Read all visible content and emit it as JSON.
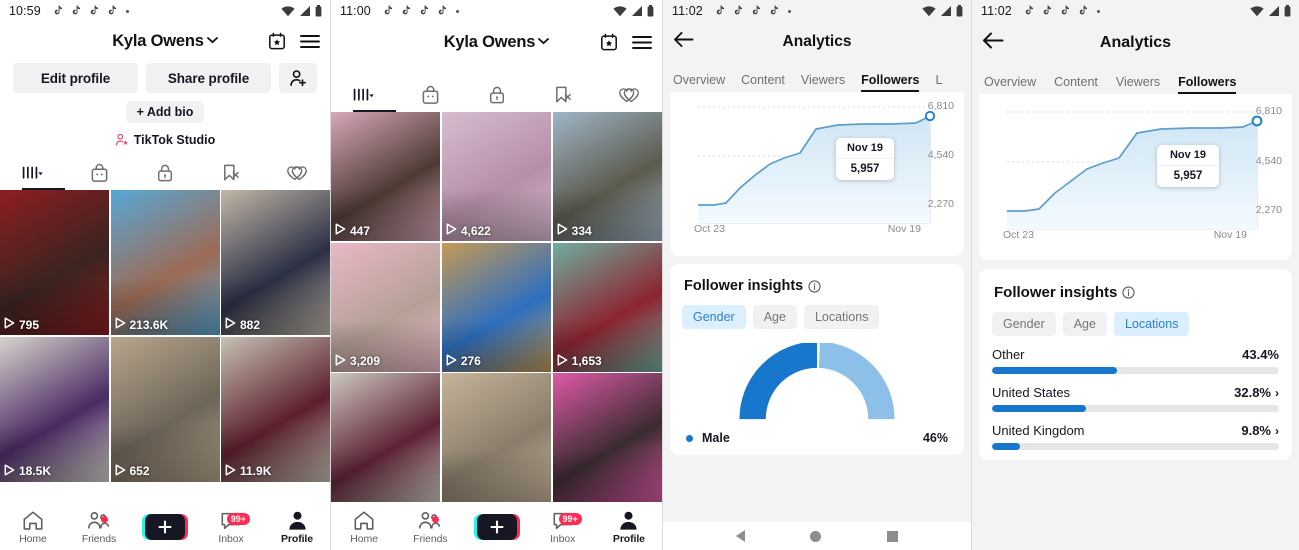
{
  "panels": {
    "p1": {
      "status": {
        "time": "10:59",
        "notes": 4
      },
      "profile": {
        "name": "Kyla Owens",
        "edit_profile": "Edit profile",
        "share_profile": "Share profile",
        "add_friend_icon": "add-person-icon",
        "add_bio": "+ Add bio",
        "studio": "TikTok Studio",
        "calendar_icon": "calendar-star-icon",
        "menu_icon": "hamburger-menu-icon"
      },
      "tabs": [
        {
          "icon": "grid-posts-icon",
          "active": true
        },
        {
          "icon": "shop-bag-icon",
          "active": false
        },
        {
          "icon": "private-lock-icon",
          "active": false
        },
        {
          "icon": "repost-bookmark-icon",
          "active": false
        },
        {
          "icon": "liked-heart-icon",
          "active": false
        }
      ],
      "videos": [
        {
          "views": "795",
          "c1": "#8e1d22",
          "c2": "#3a2420"
        },
        {
          "views": "213.6K",
          "c1": "#57a8d8",
          "c2": "#9c6b55"
        },
        {
          "views": "882",
          "c1": "#c2b7a8",
          "c2": "#2b2f44"
        },
        {
          "views": "18.5K",
          "c1": "#d8d4cd",
          "c2": "#4a2a63"
        },
        {
          "views": "652",
          "c1": "#b9a68c",
          "c2": "#6d6559"
        },
        {
          "views": "11.9K",
          "c1": "#c6c2b4",
          "c2": "#5c1f2c"
        }
      ],
      "bottom": {
        "home": "Home",
        "friends": "Friends",
        "inbox": "Inbox",
        "profile": "Profile",
        "inbox_badge": "99+"
      }
    },
    "p2": {
      "status": {
        "time": "11:00",
        "notes": 4
      },
      "profile": {
        "name": "Kyla Owens"
      },
      "videos": [
        {
          "views": "447",
          "c1": "#d8a8b8",
          "c2": "#4d3a34"
        },
        {
          "views": "4,622",
          "c1": "#d6bdd0",
          "c2": "#b58fa8"
        },
        {
          "views": "334",
          "c1": "#9fb6c6",
          "c2": "#5c5a4e"
        },
        {
          "views": "3,209",
          "c1": "#e9b8c4",
          "c2": "#b5a097"
        },
        {
          "views": "276",
          "c1": "#c59a54",
          "c2": "#2e6fc0"
        },
        {
          "views": "1,653",
          "c1": "#6fae9f",
          "c2": "#8c2430"
        },
        {
          "views": "",
          "c1": "#cdc8c0",
          "c2": "#5d2234"
        },
        {
          "views": "",
          "c1": "#c6b49a",
          "c2": "#8a7d6b"
        },
        {
          "views": "",
          "c1": "#e05aa8",
          "c2": "#3a2b30"
        }
      ],
      "bottom": {
        "home": "Home",
        "friends": "Friends",
        "inbox": "Inbox",
        "profile": "Profile",
        "inbox_badge": "99+"
      }
    },
    "p3": {
      "status": {
        "time": "11:02",
        "notes": 4
      },
      "header": {
        "title": "Analytics",
        "back_icon": "back-arrow-icon"
      },
      "tabs": [
        {
          "label": "Overview",
          "active": false
        },
        {
          "label": "Content",
          "active": false
        },
        {
          "label": "Viewers",
          "active": false
        },
        {
          "label": "Followers",
          "active": true
        },
        {
          "label": "L",
          "active": false
        }
      ],
      "insights": {
        "title": "Follower insights",
        "info_icon": "info-circle-icon",
        "segments": [
          {
            "label": "Gender",
            "active": true
          },
          {
            "label": "Age",
            "active": false
          },
          {
            "label": "Locations",
            "active": false
          }
        ],
        "legend": {
          "name": "Male",
          "value": "46%",
          "color": "#1677cc"
        }
      },
      "navbar": [
        "back-triangle-icon",
        "home-circle-icon",
        "recents-square-icon"
      ]
    },
    "p4": {
      "status": {
        "time": "11:02",
        "notes": 4
      },
      "header": {
        "title": "Analytics",
        "back_icon": "back-arrow-icon"
      },
      "tabs": [
        {
          "label": "Overview",
          "active": false
        },
        {
          "label": "Content",
          "active": false
        },
        {
          "label": "Viewers",
          "active": false
        },
        {
          "label": "Followers",
          "active": true
        }
      ],
      "insights": {
        "title": "Follower insights",
        "info_icon": "info-circle-icon",
        "segments": [
          {
            "label": "Gender",
            "active": false
          },
          {
            "label": "Age",
            "active": false
          },
          {
            "label": "Locations",
            "active": true
          }
        ],
        "locations": [
          {
            "name": "Other",
            "value": "43.4%",
            "pct": 43.4,
            "arrow": false
          },
          {
            "name": "United States",
            "value": "32.8%",
            "pct": 32.8,
            "arrow": true
          },
          {
            "name": "United Kingdom",
            "value": "9.8%",
            "pct": 9.8,
            "arrow": true
          }
        ]
      }
    }
  },
  "chart_data": {
    "type": "area",
    "title": "Followers",
    "xlabel": "",
    "ylabel": "Followers",
    "x_ticks": [
      "Oct 23",
      "Nov 19"
    ],
    "y_ticks": [
      "6,810",
      "4,540",
      "2,270"
    ],
    "ylim": [
      0,
      6810
    ],
    "grid": true,
    "legend": "none",
    "line_color": "#5d9ec9",
    "fill_top": "#cfe6f5",
    "fill_bottom": "#f2f9fd",
    "annotation": {
      "date": "Nov 19",
      "value": "5,957"
    },
    "x": [
      "Oct 23",
      "Oct 25",
      "Oct 27",
      "Oct 29",
      "Oct 31",
      "Nov 2",
      "Nov 4",
      "Nov 6",
      "Nov 8",
      "Nov 10",
      "Nov 12",
      "Nov 14",
      "Nov 16",
      "Nov 18",
      "Nov 19"
    ],
    "values": [
      2270,
      2270,
      2320,
      2900,
      3450,
      3850,
      4100,
      4500,
      5250,
      5420,
      5430,
      5440,
      5450,
      5480,
      5957
    ]
  },
  "colors": {
    "accent_blue": "#1677cc",
    "light_blue": "#8dc0e8",
    "seg_active_bg": "#dcefff",
    "seg_active_fg": "#2a7fd4",
    "tiktok_red": "#fe2c55",
    "tiktok_cyan": "#25f4ee",
    "page_bg": "#f3f3f3"
  },
  "donut": {
    "male_pct": 46,
    "female_pct": 54
  }
}
